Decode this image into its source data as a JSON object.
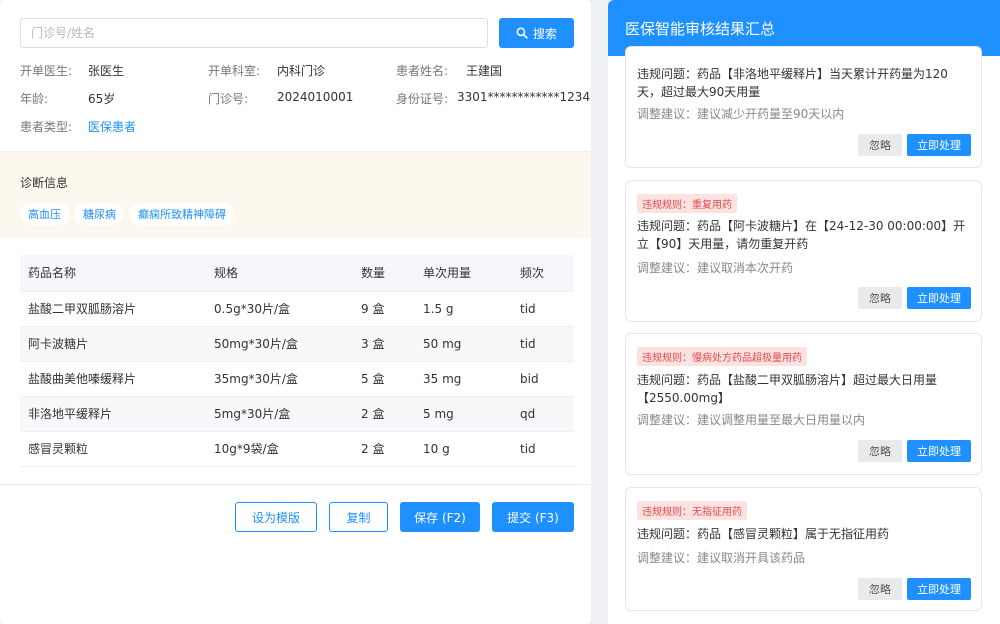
{
  "search": {
    "placeholder": "门诊号/姓名",
    "value": "",
    "button_label": "搜索"
  },
  "patient": {
    "doctor_label": "开单医生:",
    "doctor": "张医生",
    "dept_label": "开单科室:",
    "dept": "内科门诊",
    "name_label": "患者姓名:",
    "name": "王建国",
    "age_label": "年龄:",
    "age": "65岁",
    "visit_label": "门诊号:",
    "visit_no": "2024010001",
    "id_label": "身份证号:",
    "id_no": "3301************1234",
    "type_label": "患者类型:",
    "type": "医保患者"
  },
  "diagnosis": {
    "title": "诊断信息",
    "tags": [
      "高血压",
      "糖尿病",
      "癫痫所致精神障碍"
    ]
  },
  "drugs": {
    "headers": [
      "药品名称",
      "规格",
      "数量",
      "单次用量",
      "频次"
    ],
    "rows": [
      [
        "盐酸二甲双胍肠溶片",
        "0.5g*30片/盒",
        "9 盒",
        "1.5 g",
        "tid"
      ],
      [
        "阿卡波糖片",
        "50mg*30片/盒",
        "3 盒",
        "50 mg",
        "tid"
      ],
      [
        "盐酸曲美他嗪缓释片",
        "35mg*30片/盒",
        "5 盒",
        "35 mg",
        "bid"
      ],
      [
        "非洛地平缓释片",
        "5mg*30片/盒",
        "2 盒",
        "5 mg",
        "qd"
      ],
      [
        "感冒灵颗粒",
        "10g*9袋/盒",
        "2 盒",
        "10 g",
        "tid"
      ]
    ]
  },
  "actions": {
    "template": "设为模版",
    "copy": "复制",
    "save": "保存 (F2)",
    "submit": "提交 (F3)"
  },
  "review": {
    "title": "医保智能审核结果汇总",
    "ignore_label": "忽略",
    "handle_label": "立即处理",
    "cards": [
      {
        "rule": "",
        "issue": "违规问题：药品【非洛地平缓释片】当天累计开药量为120天，超过最大90天用量",
        "advice": "调整建议：建议减少开药量至90天以内"
      },
      {
        "rule": "违规规则：重复用药",
        "issue": "违规问题：药品【阿卡波糖片】在【24-12-30 00:00:00】开立【90】天用量，请勿重复开药",
        "advice": "调整建议：建议取消本次开药"
      },
      {
        "rule": "违规规则：慢病处方药品超极量用药",
        "issue": "违规问题：药品【盐酸二甲双胍肠溶片】超过最大日用量【2550.00mg】",
        "advice": "调整建议：建议调整用量至最大日用量以内"
      },
      {
        "rule": "违规规则：无指征用药",
        "issue": "违规问题：药品【感冒灵颗粒】属于无指征用药",
        "advice": "调整建议：建议取消开具该药品"
      }
    ]
  },
  "colors": {
    "primary": "#1e90ff",
    "danger_text": "#e34b4b",
    "danger_bg": "#fde2e2",
    "diag_bg": "#fdf8ee"
  },
  "icons": {
    "search": "search-icon"
  }
}
